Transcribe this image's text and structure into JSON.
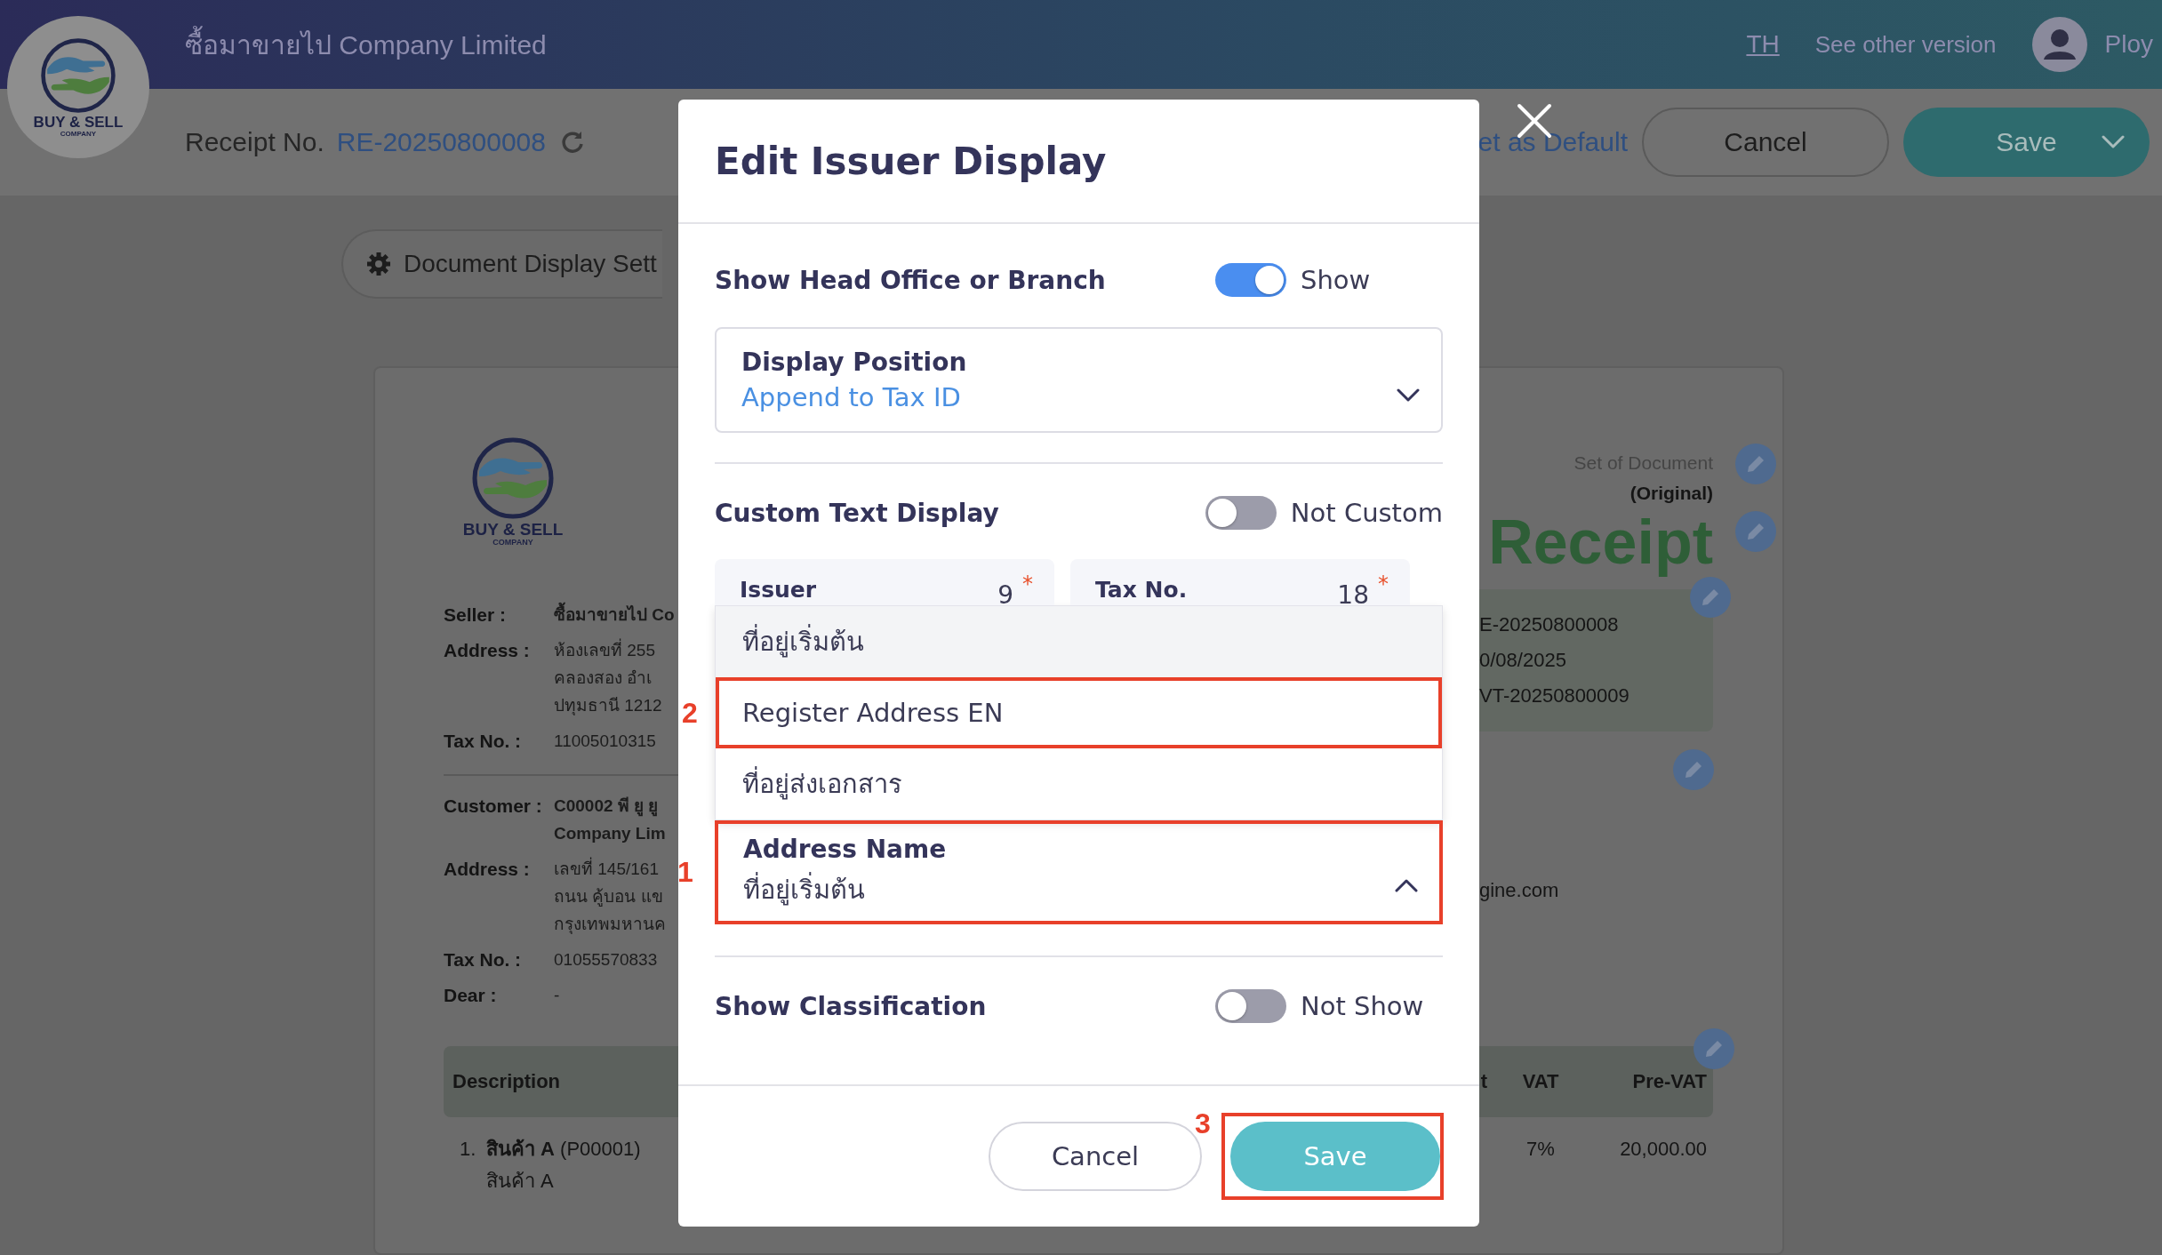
{
  "header": {
    "logo": {
      "line1": "BUY & SELL",
      "line2": "COMPANY"
    },
    "company": "ซื้อมาขายไป Company Limited",
    "language": "TH",
    "version_link": "See other version",
    "user": "Ploy"
  },
  "toolbar": {
    "receipt_label": "Receipt No.",
    "receipt_no": "RE-20250800008",
    "default_link": "et as Default",
    "cancel": "Cancel",
    "save": "Save"
  },
  "settings_button": "Document Display Sett",
  "document": {
    "logo": {
      "line1": "BUY & SELL",
      "line2": "COMPANY"
    },
    "seller_rows": [
      {
        "label": "Seller :",
        "lines": [
          "ซื้อมาขายไป Co"
        ],
        "emphasis": true
      },
      {
        "label": "Address :",
        "lines": [
          "ห้องเลขที่ 255",
          "คลองสอง อำเ",
          "ปทุมธานี 1212"
        ],
        "emphasis": false
      },
      {
        "label": "Tax No. :",
        "lines": [
          "11005010315"
        ],
        "emphasis": false
      }
    ],
    "customer_rows": [
      {
        "label": "Customer :",
        "lines": [
          "C00002 พี ยู ยู",
          "Company Lim"
        ],
        "emphasis": true
      },
      {
        "label": "Address :",
        "lines": [
          "เลขที่ 145/161",
          "ถนน คู้บอน  แข",
          "กรุงเทพมหานค"
        ],
        "emphasis": false
      },
      {
        "label": "Tax No. :",
        "lines": [
          "01055570833"
        ],
        "emphasis": false
      },
      {
        "label": "Dear :",
        "lines": [
          "-"
        ],
        "emphasis": false
      }
    ],
    "copy_label": "Set of Document",
    "copy_type": "(Original)",
    "title": "Receipt",
    "info_lines": [
      "E-20250800008",
      "0/08/2025",
      "VT-20250800009"
    ],
    "email_fragment": "gine.com",
    "table": {
      "columns": [
        "Description",
        "t",
        "VAT",
        "Pre-VAT"
      ],
      "rows": [
        {
          "number": "1.",
          "name": "**สินค้า A** (P00001)",
          "detail": "สินค้า A",
          "vat": "7%",
          "pre_vat": "20,000.00"
        }
      ]
    }
  },
  "dialog": {
    "title": "Edit Issuer Display",
    "head_office": {
      "label": "Show Head Office or Branch",
      "on": true,
      "state_text": "Show"
    },
    "display_position": {
      "label": "Display Position",
      "value": "Append to Tax ID",
      "expanded": false
    },
    "custom_text": {
      "label": "Custom Text Display",
      "on": false,
      "state_text": "Not Custom"
    },
    "fields": [
      {
        "label": "Issuer",
        "count": "9",
        "mark": "*"
      },
      {
        "label": "Tax No.",
        "count": "18",
        "mark": "*"
      }
    ],
    "address_options": [
      {
        "label": "ที่อยู่เริ่มต้น",
        "selected": true
      },
      {
        "label": "Register Address EN",
        "selected": false,
        "annotation": "2"
      },
      {
        "label": "ที่อยู่ส่งเอกสาร",
        "selected": false
      }
    ],
    "address_name": {
      "label": "Address Name",
      "value": "ที่อยู่เริ่มต้น",
      "expanded": true,
      "annotation": "1"
    },
    "classification": {
      "label": "Show Classification",
      "on": false,
      "state_text": "Not Show"
    },
    "cancel": "Cancel",
    "save": {
      "label": "Save",
      "annotation": "3"
    }
  }
}
